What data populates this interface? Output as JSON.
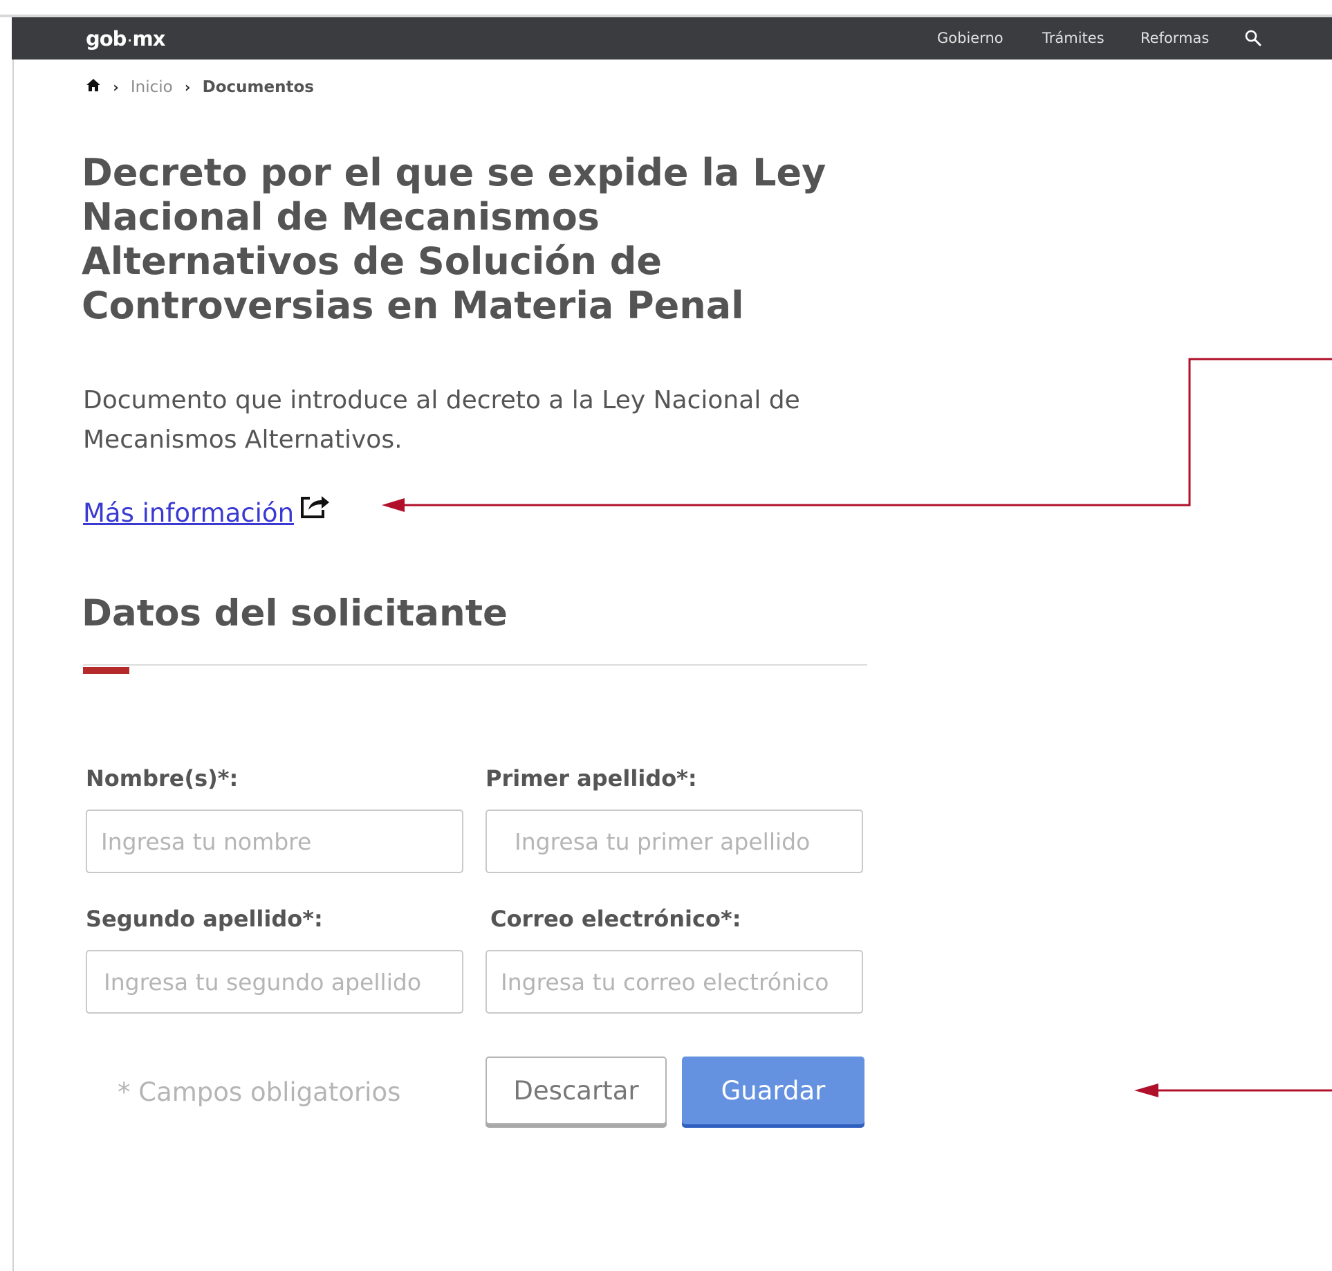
{
  "header": {
    "logo": "gob",
    "logo_suffix": "mx",
    "nav": [
      "Gobierno",
      "Trámites",
      "Reformas"
    ],
    "search_icon": "search-icon"
  },
  "breadcrumb": {
    "home_icon": "home-icon",
    "items": [
      "Inicio",
      "Documentos"
    ]
  },
  "document": {
    "title": "Decreto por el que se expide la Ley Nacional de Mecanismos Alternativos de Solución de Controversias en Materia Penal",
    "description": "Documento que introduce al decreto a la Ley Nacional de Mecanismos Alternativos.",
    "more_link": "Más información",
    "share_icon": "external-share-icon"
  },
  "form": {
    "section_title": "Datos del solicitante",
    "fields": [
      {
        "label": "Nombre(s)*:",
        "placeholder": "Ingresa tu nombre",
        "value": ""
      },
      {
        "label": "Primer apellido*:",
        "placeholder": "Ingresa tu primer apellido",
        "value": ""
      },
      {
        "label": "Segundo apellido*:",
        "placeholder": "Ingresa tu segundo apellido",
        "value": ""
      },
      {
        "label": "Correo electrónico*:",
        "placeholder": "Ingresa tu correo electrónico",
        "value": ""
      }
    ],
    "required_note": "* Campos obligatorios",
    "discard_label": "Descartar",
    "save_label": "Guardar"
  },
  "colors": {
    "navbar": "#3b3c3f",
    "accent_red": "#b52b2b",
    "annotation_red": "#b0102a",
    "link": "#3a3ad2",
    "primary_button": "#6492e0"
  }
}
